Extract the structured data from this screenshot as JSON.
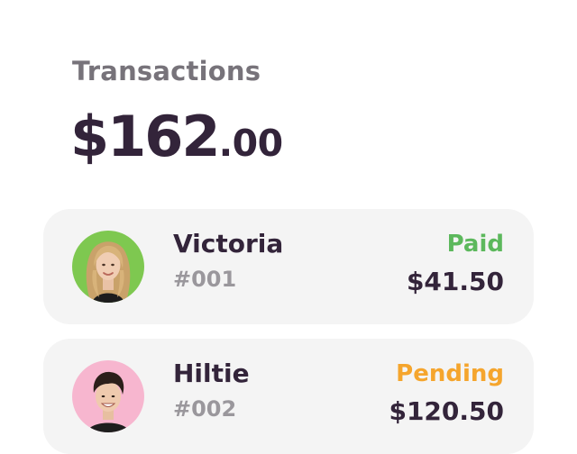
{
  "header": {
    "title": "Transactions",
    "total_major": "$162",
    "total_minor": ".00"
  },
  "transactions": [
    {
      "name": "Victoria",
      "id": "#001",
      "status": "Paid",
      "status_color": "#5cb85c",
      "amount": "$41.50",
      "avatar_bg": "#7ec850"
    },
    {
      "name": "Hiltie",
      "id": "#002",
      "status": "Pending",
      "status_color": "#f5a52d",
      "amount": "$120.50",
      "avatar_bg": "#f7b6cf"
    }
  ],
  "colors": {
    "text_dark": "#33243a",
    "text_muted": "#9a979c",
    "card_bg": "#f4f4f4"
  }
}
